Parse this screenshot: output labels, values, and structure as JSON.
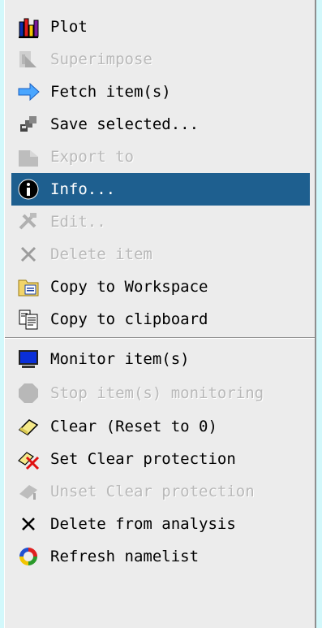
{
  "menu": {
    "items": [
      {
        "label": "Plot",
        "icon": "bar-chart-icon",
        "enabled": true
      },
      {
        "label": "Superimpose",
        "icon": "superimpose-icon",
        "enabled": false
      },
      {
        "label": "Fetch item(s)",
        "icon": "arrow-right-icon",
        "enabled": true
      },
      {
        "label": "Save selected...",
        "icon": "save-icon",
        "enabled": true
      },
      {
        "label": "Export to",
        "icon": "export-icon",
        "enabled": false
      },
      {
        "label": "Info...",
        "icon": "info-icon",
        "enabled": true,
        "selected": true
      },
      {
        "label": "Edit..",
        "icon": "tools-icon",
        "enabled": false
      },
      {
        "label": "Delete item",
        "icon": "delete-x-icon",
        "enabled": false
      },
      {
        "label": "Copy to Workspace",
        "icon": "folder-copy-icon",
        "enabled": true
      },
      {
        "label": "Copy to clipboard",
        "icon": "clipboard-icon",
        "enabled": true
      },
      {
        "label": "Monitor item(s)",
        "icon": "monitor-icon",
        "enabled": true
      },
      {
        "label": "Stop item(s) monitoring",
        "icon": "stop-icon",
        "enabled": false
      },
      {
        "label": "Clear (Reset to 0)",
        "icon": "eraser-icon",
        "enabled": true
      },
      {
        "label": "Set Clear protection",
        "icon": "eraser-protect-icon",
        "enabled": true
      },
      {
        "label": "Unset Clear protection",
        "icon": "eraser-unprotect-icon",
        "enabled": false
      },
      {
        "label": "Delete from analysis",
        "icon": "delete-x-icon",
        "enabled": true
      },
      {
        "label": "Refresh namelist",
        "icon": "refresh-icon",
        "enabled": true
      }
    ]
  },
  "colors": {
    "background": "#d2f8fb",
    "menu_bg": "#ececec",
    "selected_bg": "#1e5f8f",
    "disabled_text": "#b9b9b9"
  }
}
